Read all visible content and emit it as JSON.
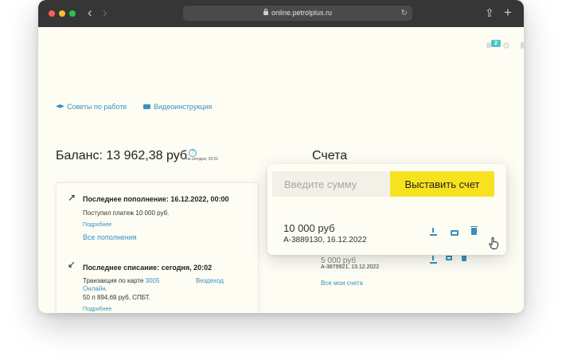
{
  "browser": {
    "url": "online.petrolplus.ru",
    "back_glyph": "‹",
    "forward_glyph": "›",
    "share_glyph": "⇪",
    "newtab_glyph": "+",
    "reload_glyph": "↻"
  },
  "header": {
    "notifications_count": "2",
    "settings_glyph": "⚙"
  },
  "links": {
    "tips": "Советы по работе",
    "video": "Видеоинструкция"
  },
  "balance": {
    "label": "Баланс: 13 962,38 руб",
    "help_glyph": "?",
    "as_of": "на сегодня, 20:51"
  },
  "accounts": {
    "title": "Счета",
    "popup": {
      "input_placeholder": "Введите сумму",
      "issue_button": "Выставить счет",
      "item_sum": "10 000 руб",
      "item_number": "А-3889130, 16.12.2022"
    },
    "list_item": {
      "sum": "5 000 руб",
      "number": "А-3879921, 13.12.2022"
    },
    "all_link": "Все мои счета"
  },
  "card": {
    "topup": {
      "arrow": "↗",
      "title": "Последнее пополнение: 16.12.2022, 00:00",
      "desc": "Поступил платеж 10 000 руб.",
      "more": "Подробнее",
      "all": "Все пополнения"
    },
    "debit": {
      "arrow": "↙",
      "title": "Последнее списание: сегодня, 20:02",
      "desc_prefix": "Транзакция по карте",
      "card_num": "3005",
      "place": "Вездеход",
      "place_suffix": "Онлайн.",
      "amount": "50 л 894,69 руб, СПБТ.",
      "more": "Подробнее"
    }
  },
  "colors": {
    "accent_yellow": "#f7e21f",
    "link_blue": "#3a8fbf",
    "badge_teal": "#4fc3c9"
  }
}
